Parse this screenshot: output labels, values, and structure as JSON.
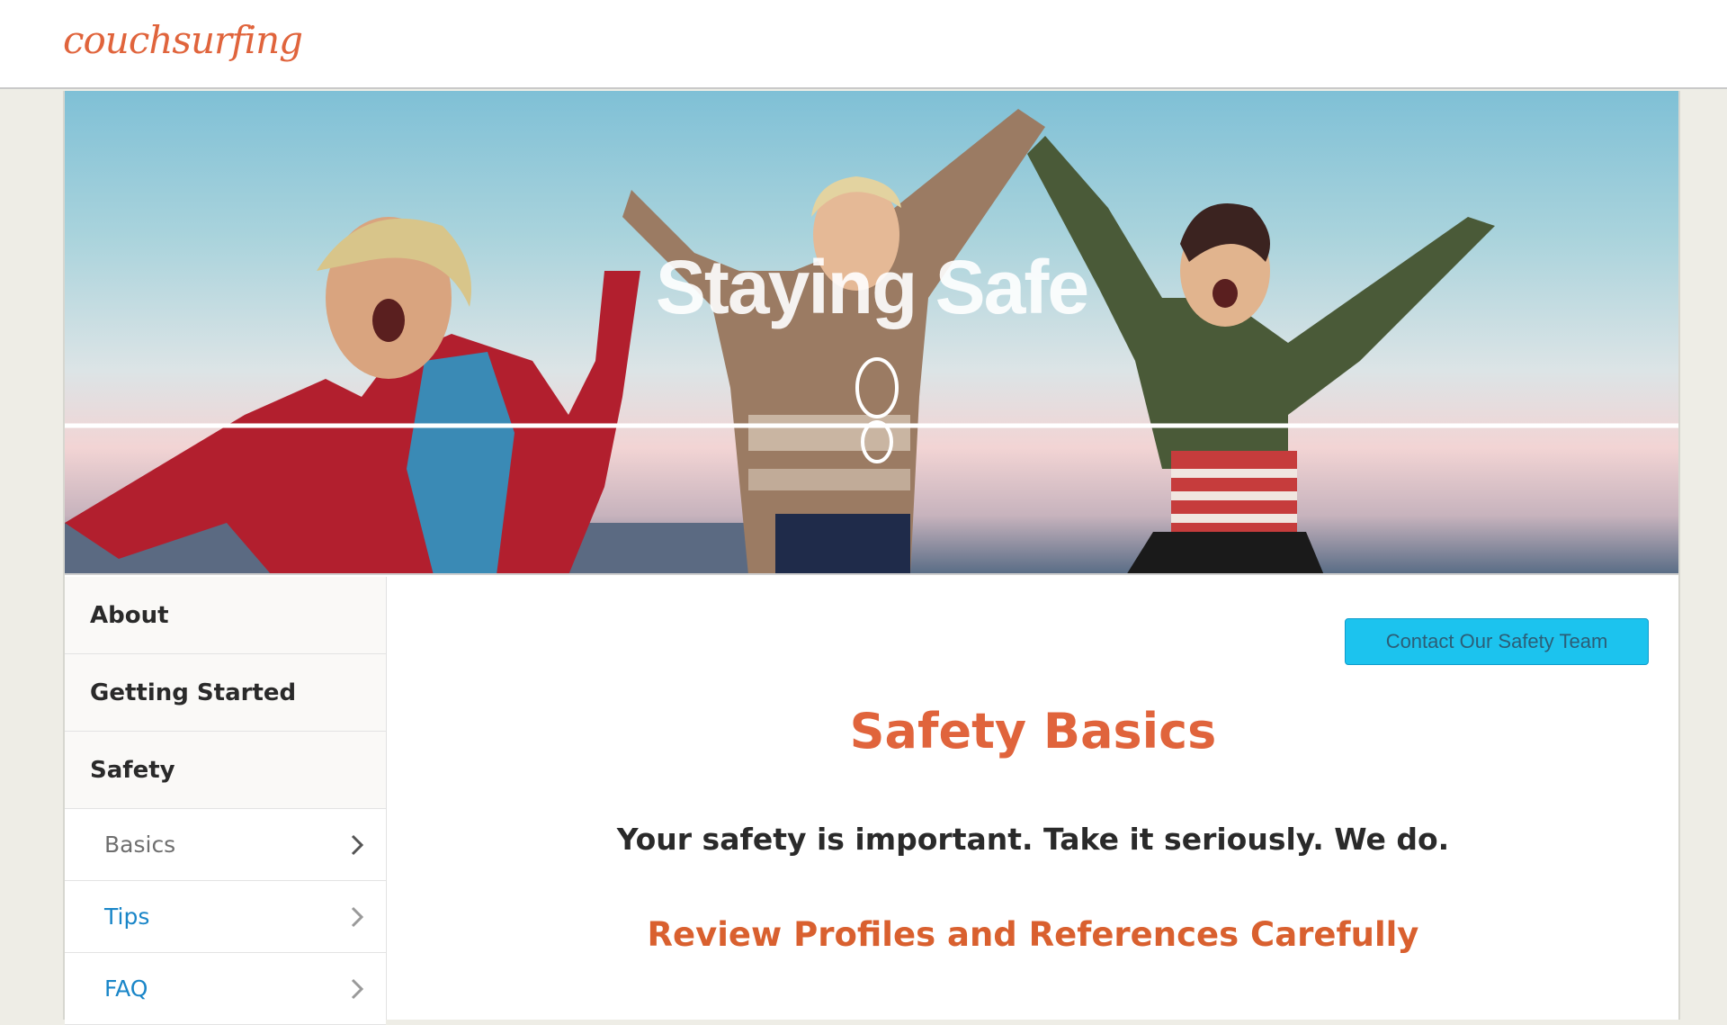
{
  "header": {
    "logo_text": "couchsurfing"
  },
  "hero": {
    "title": "Staying Safe"
  },
  "sidebar": {
    "sections": [
      {
        "label": "About"
      },
      {
        "label": "Getting Started"
      },
      {
        "label": "Safety"
      }
    ],
    "sub_items": [
      {
        "label": "Basics",
        "state": "active"
      },
      {
        "label": "Tips",
        "state": "link"
      },
      {
        "label": "FAQ",
        "state": "link"
      }
    ]
  },
  "main": {
    "contact_button_label": "Contact Our Safety Team",
    "title": "Safety Basics",
    "tagline": "Your safety is important. Take it seriously. We do.",
    "section_heading": "Review Profiles and References Carefully"
  },
  "colors": {
    "brand_orange": "#e0643c",
    "link_blue": "#1a86c8",
    "button_cyan": "#1cc3ee",
    "page_background": "#eeede6"
  },
  "icons": [
    "chevron-right-icon"
  ]
}
